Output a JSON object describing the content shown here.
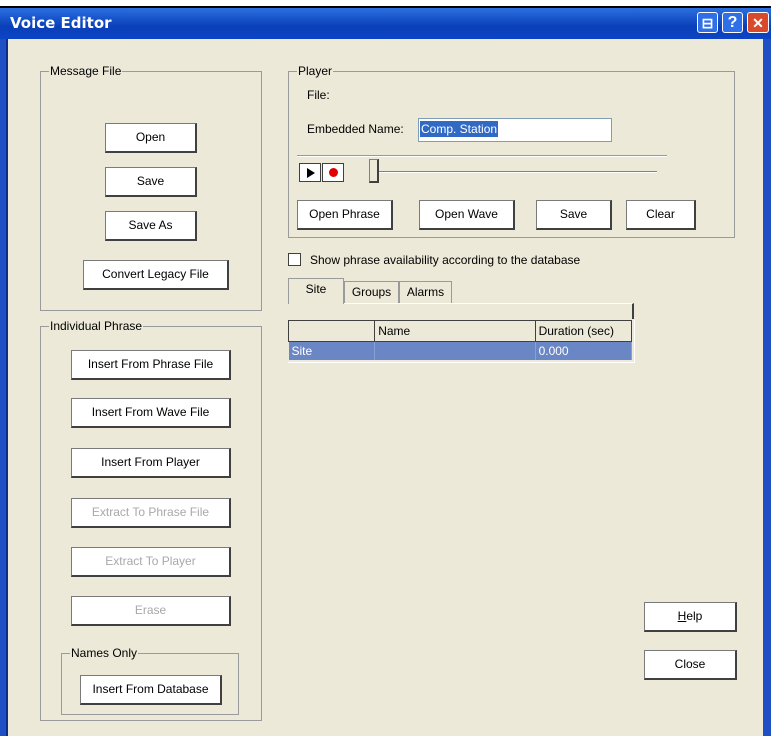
{
  "window": {
    "title": "Voice Editor",
    "help_button": "?",
    "maximize_button": "⊟",
    "close_button": "✕"
  },
  "message_file": {
    "legend": "Message File",
    "open": "Open",
    "save": "Save",
    "save_as": "Save As",
    "convert": "Convert Legacy File"
  },
  "individual_phrase": {
    "legend": "Individual Phrase",
    "insert_phrase_file": "Insert From Phrase File",
    "insert_wave_file": "Insert From Wave File",
    "insert_player": "Insert From Player",
    "extract_phrase_file": "Extract To Phrase File",
    "extract_player": "Extract To Player",
    "erase": "Erase",
    "names_only": {
      "legend": "Names Only",
      "insert_database": "Insert From Database"
    }
  },
  "player": {
    "legend": "Player",
    "file_label": "File:",
    "embedded_label": "Embedded Name:",
    "embedded_value": "Comp. Station",
    "open_phrase": "Open Phrase",
    "open_wave": "Open Wave",
    "save": "Save",
    "clear": "Clear",
    "position": 0
  },
  "show_availability": {
    "label": "Show phrase availability according to the database",
    "checked": false
  },
  "tabs": [
    "Site",
    "Groups",
    "Alarms"
  ],
  "table": {
    "headers": [
      "",
      "Name",
      "Duration (sec)"
    ],
    "rows": [
      [
        "Site",
        "",
        "0.000"
      ]
    ]
  },
  "help": "Help",
  "close": "Close",
  "colors": {
    "titlebar": "#0c44c4",
    "selection": "#6a86c4",
    "record": "#e00000"
  }
}
